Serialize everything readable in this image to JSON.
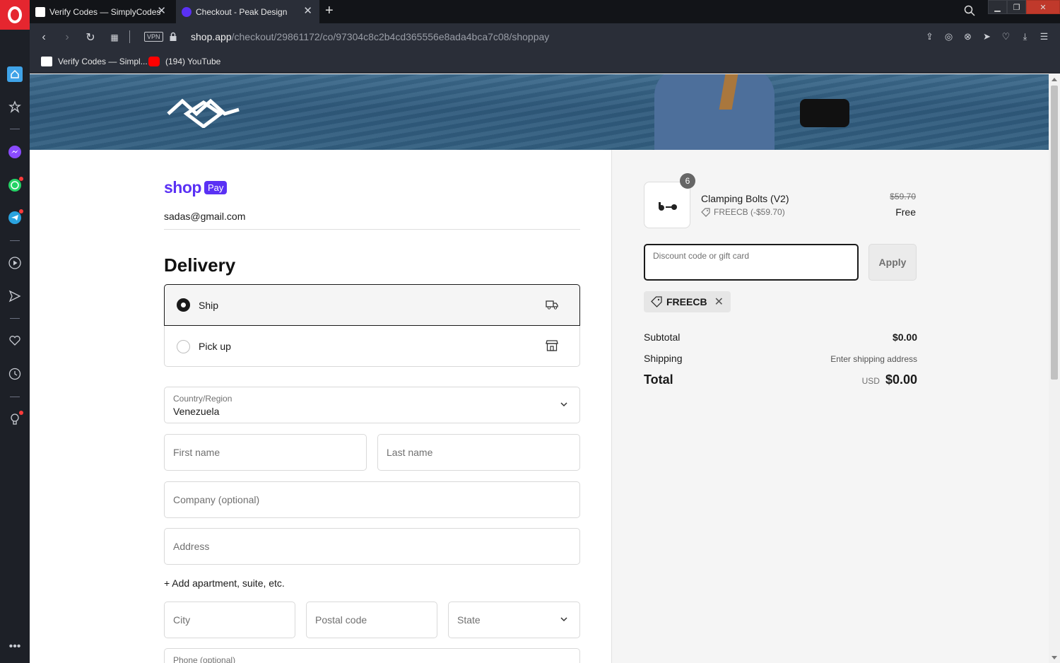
{
  "browser": {
    "tabs": [
      {
        "title": "Verify Codes — SimplyCodes",
        "active": false
      },
      {
        "title": "Checkout - Peak Design",
        "active": true
      }
    ],
    "url_host": "shop.app",
    "url_path": "/checkout/29861172/co/97304c8c2b4cd365556e8ada4bca7c08/shoppay",
    "vpn_label": "VPN",
    "bookmarks": [
      {
        "label": "Verify Codes — Simpl..."
      },
      {
        "label": "(194) YouTube"
      }
    ]
  },
  "checkout": {
    "brand_shop": "shop",
    "brand_pay": "Pay",
    "email": "sadas@gmail.com",
    "delivery_heading": "Delivery",
    "delivery_options": [
      {
        "label": "Ship",
        "selected": true,
        "icon": "truck-icon"
      },
      {
        "label": "Pick up",
        "selected": false,
        "icon": "store-icon"
      }
    ],
    "country_label": "Country/Region",
    "country_value": "Venezuela",
    "first_name_placeholder": "First name",
    "last_name_placeholder": "Last name",
    "company_placeholder": "Company (optional)",
    "address_placeholder": "Address",
    "add_apartment": "+ Add apartment, suite, etc.",
    "city_placeholder": "City",
    "postal_placeholder": "Postal code",
    "state_placeholder": "State",
    "phone_label": "Phone (optional)"
  },
  "summary": {
    "product_qty": "6",
    "product_name": "Clamping Bolts (V2)",
    "product_discount": "FREECB (-$59.70)",
    "product_old_price": "$59.70",
    "product_price": "Free",
    "discount_placeholder": "Discount code or gift card",
    "apply_label": "Apply",
    "applied_code": "FREECB",
    "subtotal_label": "Subtotal",
    "subtotal_value": "$0.00",
    "shipping_label": "Shipping",
    "shipping_value": "Enter shipping address",
    "total_label": "Total",
    "total_currency": "USD",
    "total_value": "$0.00"
  },
  "colors": {
    "shop_purple": "#5a31f4",
    "opera_red": "#e5262f"
  }
}
